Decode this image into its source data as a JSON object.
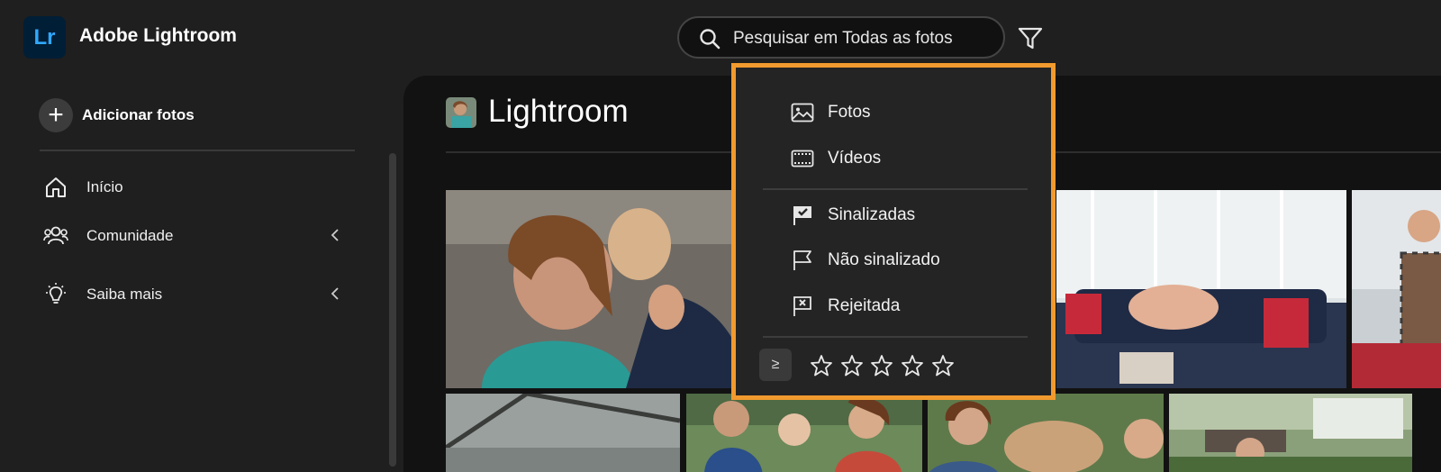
{
  "header": {
    "logo_text": "Lr",
    "app_title": "Adobe Lightroom",
    "search_placeholder": "Pesquisar em Todas as fotos",
    "search_icon": "search-icon",
    "filter_icon": "filter-icon"
  },
  "sidebar": {
    "add_photos": "Adicionar fotos",
    "items": [
      {
        "label": "Início",
        "icon": "home-icon"
      },
      {
        "label": "Comunidade",
        "icon": "community-icon"
      },
      {
        "label": "Saiba mais",
        "icon": "lightbulb-icon"
      }
    ]
  },
  "main": {
    "album_title": "Lightroom"
  },
  "filter_menu": {
    "items": [
      {
        "label": "Fotos",
        "icon": "image-icon"
      },
      {
        "label": "Vídeos",
        "icon": "video-icon"
      },
      {
        "label": "Sinalizadas",
        "icon": "flag-checked-icon"
      },
      {
        "label": "Não sinalizado",
        "icon": "flag-icon"
      },
      {
        "label": "Rejeitada",
        "icon": "flag-rejected-icon"
      }
    ],
    "rating_operator": "≥",
    "rating_stars": 5,
    "highlight_color": "#f19a2e"
  },
  "colors": {
    "background": "#1f1f1f",
    "panel": "#121212",
    "lr_blue": "#31a8ff",
    "lr_dark": "#001e36"
  }
}
